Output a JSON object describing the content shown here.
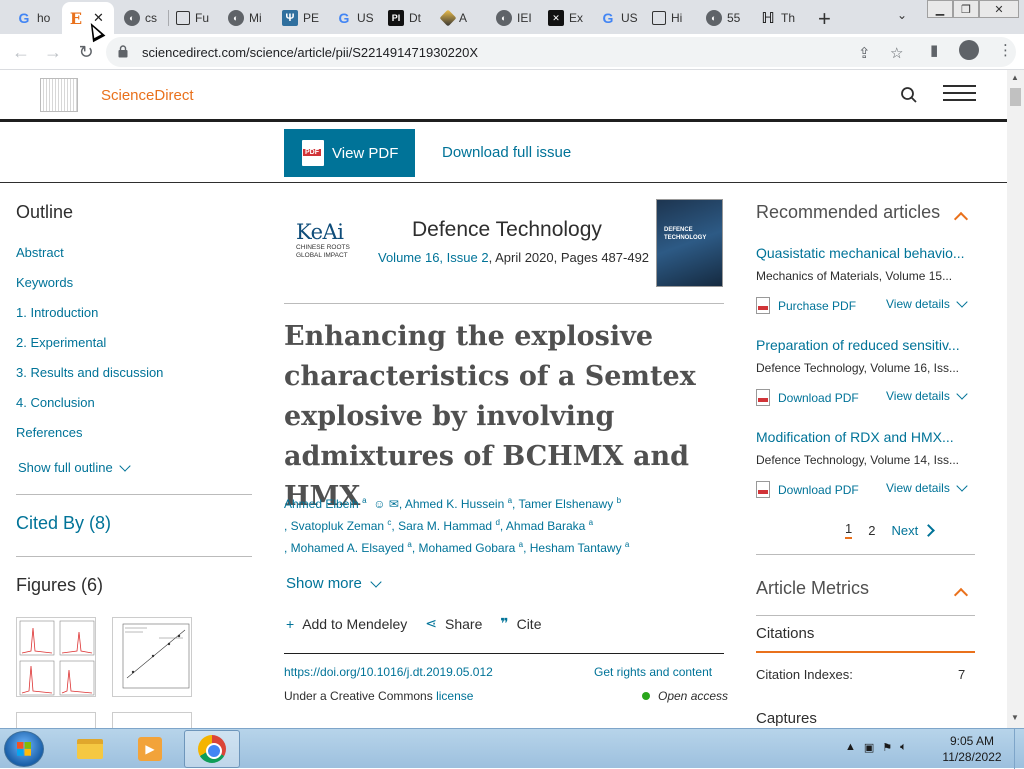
{
  "browser": {
    "tabs": [
      {
        "label": "ho",
        "icon": "google-icon"
      },
      {
        "label": "E",
        "icon": "elsevier-icon",
        "active": true
      },
      {
        "label": "cs",
        "icon": "globe-icon"
      },
      {
        "label": "Fu",
        "icon": "library-icon"
      },
      {
        "label": "Mi",
        "icon": "globe-icon"
      },
      {
        "label": "PE",
        "icon": "institution-icon"
      },
      {
        "label": "US",
        "icon": "google-icon"
      },
      {
        "label": "Dt",
        "icon": "pi-icon"
      },
      {
        "label": "A",
        "icon": "diamond-icon"
      },
      {
        "label": "IEI",
        "icon": "globe-icon"
      },
      {
        "label": "Ex",
        "icon": "ex-icon"
      },
      {
        "label": "US",
        "icon": "google-icon"
      },
      {
        "label": "Hi",
        "icon": "book-icon"
      },
      {
        "label": "55",
        "icon": "globe-icon"
      },
      {
        "label": "Th",
        "icon": "hash-icon"
      }
    ],
    "url": "sciencedirect.com/science/article/pii/S221491471930220X"
  },
  "site": {
    "brand": "ScienceDirect",
    "view_pdf": "View PDF",
    "download_issue": "Download full issue"
  },
  "outline": {
    "heading": "Outline",
    "items": [
      "Abstract",
      "Keywords",
      "1. Introduction",
      "2. Experimental",
      "3. Results and discussion",
      "4. Conclusion",
      "References"
    ],
    "show_full": "Show full outline",
    "cited_by": "Cited By (8)",
    "figures": "Figures (6)"
  },
  "journal": {
    "publisher_name": "KeAi",
    "publisher_tagline_1": "CHINESE ROOTS",
    "publisher_tagline_2": "GLOBAL IMPACT",
    "title": "Defence Technology",
    "volume_issue": "Volume 16, Issue 2",
    "date_pages": ", April 2020, Pages 487-492",
    "cover_text_1": "DEFENCE",
    "cover_text_2": "TECHNOLOGY"
  },
  "article": {
    "title": "Enhancing the explosive characteristics of a Semtex explosive by involving admixtures of BCHMX and HMX",
    "authors": [
      {
        "name": "Ahmed Elbeih",
        "aff": "a"
      },
      {
        "name": "Ahmed K. Hussein",
        "aff": "a"
      },
      {
        "name": "Tamer Elshenawy",
        "aff": "b"
      },
      {
        "name": "Svatopluk Zeman",
        "aff": "c"
      },
      {
        "name": "Sara M. Hammad",
        "aff": "d"
      },
      {
        "name": "Ahmad Baraka",
        "aff": "a"
      },
      {
        "name": "Mohamed A. Elsayed",
        "aff": "a"
      },
      {
        "name": "Mohamed Gobara",
        "aff": "a"
      },
      {
        "name": "Hesham Tantawy",
        "aff": "a"
      }
    ],
    "show_more": "Show more",
    "add_mendeley": "Add to Mendeley",
    "share": "Share",
    "cite": "Cite",
    "doi": "https://doi.org/10.1016/j.dt.2019.05.012",
    "rights": "Get rights and content",
    "cc_prefix": "Under a Creative Commons",
    "cc_link": "license",
    "open_access": "Open access"
  },
  "recommended": {
    "heading": "Recommended articles",
    "items": [
      {
        "title": "Quasistatic mechanical behavio...",
        "source": "Mechanics of Materials, Volume 15...",
        "pdf": "Purchase PDF",
        "details": "View details"
      },
      {
        "title": "Preparation of reduced sensitiv...",
        "source": "Defence Technology, Volume 16, Iss...",
        "pdf": "Download PDF",
        "details": "View details"
      },
      {
        "title": "Modification of RDX and HMX...",
        "source": "Defence Technology, Volume 14, Iss...",
        "pdf": "Download PDF",
        "details": "View details"
      }
    ],
    "page_1": "1",
    "page_2": "2",
    "next": "Next"
  },
  "metrics": {
    "heading": "Article Metrics",
    "citations": "Citations",
    "citation_indexes": "Citation Indexes:",
    "citation_indexes_value": "7",
    "captures": "Captures"
  },
  "taskbar": {
    "time": "9:05 AM",
    "date": "11/28/2022"
  },
  "colors": {
    "link": "#007398",
    "brand_orange": "#e9711c",
    "view_pdf_bg": "#007398"
  }
}
